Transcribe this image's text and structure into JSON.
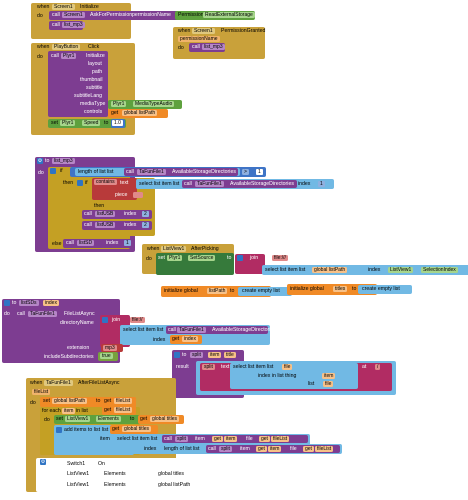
{
  "blocks": {
    "init": {
      "when": "when",
      "component": "Screen1",
      "event": "Initialize",
      "do": "do",
      "call": "call",
      "method": "AskForPermission",
      "param": "permissionName",
      "permission": "Permission",
      "perm_value": "ReadExternalStorage",
      "call2": "call",
      "proc_call": "list_mp3"
    },
    "granted": {
      "when": "when",
      "component": "Screen1",
      "event": "PermissionGranted",
      "param": "permissionName",
      "do": "do",
      "call": "call",
      "proc_call": "list_mp3"
    },
    "playclick": {
      "when": "when",
      "component": "PlayButton",
      "event": "Click",
      "do": "do",
      "call": "call",
      "player": "Plyr1",
      "method": "Initialize",
      "params": [
        "layout",
        "path",
        "thumbnail",
        "subtitle",
        "subtitleLang",
        "mediaType",
        "controls"
      ],
      "media_player": "Plyr1",
      "media_type": "MediaTypeAudio",
      "get": "get",
      "global_listpath": "global listPath",
      "set": "set",
      "speed_comp": "Plyr1",
      "speed_prop": "Speed",
      "to": "to",
      "speed_val": "1.0"
    },
    "proc_list": {
      "to": "to",
      "name": "list_mp3",
      "do": "do",
      "if": "if",
      "length_label": "length of list  list",
      "call": "call",
      "storage": "TaFunFile1",
      "method": "AvailableStorageDirectories",
      "gt": ">",
      "one": "1",
      "then": "then",
      "contains": "contains",
      "text_label": "text",
      "select_label": "select list item  list",
      "index": "index",
      "piece": "piece",
      "piece_val": "",
      "then2": "then",
      "list_sd": "listUSB",
      "index_label": "index",
      "two": "2",
      "else": "else",
      "else2": "else",
      "list1": "listSD",
      "one2": "1"
    },
    "afterpick": {
      "when": "when",
      "component": "ListView1",
      "event": "AfterPicking",
      "do": "do",
      "set": "set",
      "comp": "Plyr1",
      "prop": "SetSource",
      "to": "to",
      "join": "join",
      "file": "file:///",
      "select": "select list item  list",
      "get": "get",
      "var": "global listPath",
      "index": "index",
      "lv": "ListView1",
      "sel": "SelectionIndex"
    },
    "globals": {
      "g1": "initialize global",
      "n1": "listPath",
      "to1": "to",
      "v1": "create empty list",
      "g2": "initialize global",
      "n2": "titles",
      "to2": "to",
      "v2": "create empty list"
    },
    "proc_list2": {
      "to": "to",
      "name": "listSDs",
      "arg": "index",
      "do": "do",
      "call": "call",
      "comp": "TaFunFile1",
      "method": "FileListAsync",
      "dirname": "directoryName",
      "join": "join",
      "fileroot": "file://",
      "select": "select list item  list",
      "call2": "call",
      "comp2": "TaFunFile1",
      "method2": "AvailableStorageDirectories",
      "index": "index",
      "get": "get",
      "idx": "index",
      "ext": "extension",
      "ext_val": "mp3",
      "incsub": "includeSubdirectories",
      "true": "true"
    },
    "split_proc": {
      "to": "to",
      "name": "split",
      "arg1": "item",
      "arg2": "title",
      "result": "result",
      "split": "split",
      "text": "text",
      "select": "select list item  list",
      "get": "get",
      "file": "file",
      "index": "index in list  thing",
      "getitem": "get",
      "item": "item",
      "list": "list",
      "getfile": "get",
      "fileb": "file",
      "at": "at",
      "slash": "/"
    },
    "afterlist": {
      "when": "when",
      "component": "TaFunFile1",
      "event": "AfterFileListAsync",
      "fileList": "fileList",
      "do": "do",
      "set": "set",
      "var": "global listPath",
      "to": "to",
      "get": "get",
      "getvar": "fileList",
      "foreach": "for each",
      "item": "item",
      "inlist": "in list",
      "get2": "get",
      "var2": "fileList",
      "do2": "do",
      "set2": "set",
      "lv": "ListView1",
      "prop": "Elements",
      "to2": "to",
      "get3": "get",
      "var3": "global titles",
      "add": "add items to list",
      "listlbl": "list",
      "get4": "get",
      "var4": "global titles",
      "itemlbl": "item",
      "select": "select list item  list",
      "call": "call",
      "split": "split",
      "item2": "item",
      "get5": "get",
      "var5": "item",
      "file2": "file",
      "get6": "get",
      "var6": "fileList",
      "index": "index",
      "length": "length of list  list",
      "call2": "call",
      "split2": "split",
      "item3": "item",
      "get7": "get",
      "var7": "item",
      "file3": "file",
      "get8": "get",
      "var8": "fileList"
    },
    "bottom": {
      "gear": "⚙",
      "switch": "Switch1",
      "switch_prop": "On",
      "lv1": "ListView1",
      "lv1_prop": "Elements",
      "titles": "global titles",
      "lv2": "ListView1",
      "lv2_prop": "Elements",
      "path": "global listPath"
    }
  },
  "colors": {
    "event": "#c9a13a",
    "procedure": "#7d3d91",
    "component": "#6f9a3e",
    "list": "#71b9e4",
    "variable": "#f08a26",
    "text": "#b83a3a",
    "math": "#3f74c6"
  }
}
